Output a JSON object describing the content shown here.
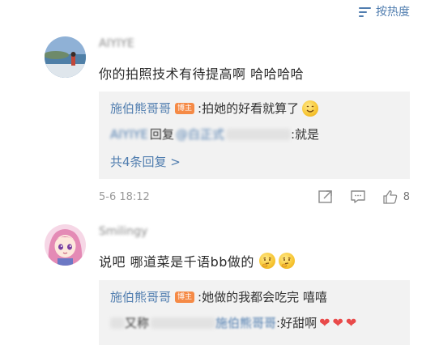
{
  "sort": {
    "label": "按热度"
  },
  "comments": [
    {
      "username": "AIYIYE",
      "content": "你的拍照技术有待提高啊 哈哈哈哈",
      "replies": [
        {
          "user": "施伯熊哥哥",
          "badge": "博主",
          "text": ":拍她的好看就算了"
        },
        {
          "user": "AIYIYE",
          "text_prefix": "回复",
          "mention": "@白正式",
          "text": ":就是"
        }
      ],
      "more": "共4条回复 >",
      "time": "5-6 18:12",
      "likes": "8"
    },
    {
      "username": "Smilingy",
      "content": "说吧 哪道菜是千语bb做的",
      "replies": [
        {
          "user": "施伯熊哥哥",
          "badge": "博主",
          "text": ":她做的我都会吃完 嘻嘻"
        },
        {
          "user": "又称",
          "reply_target": "施伯熊哥哥",
          "text": ":好甜啊"
        }
      ]
    }
  ]
}
